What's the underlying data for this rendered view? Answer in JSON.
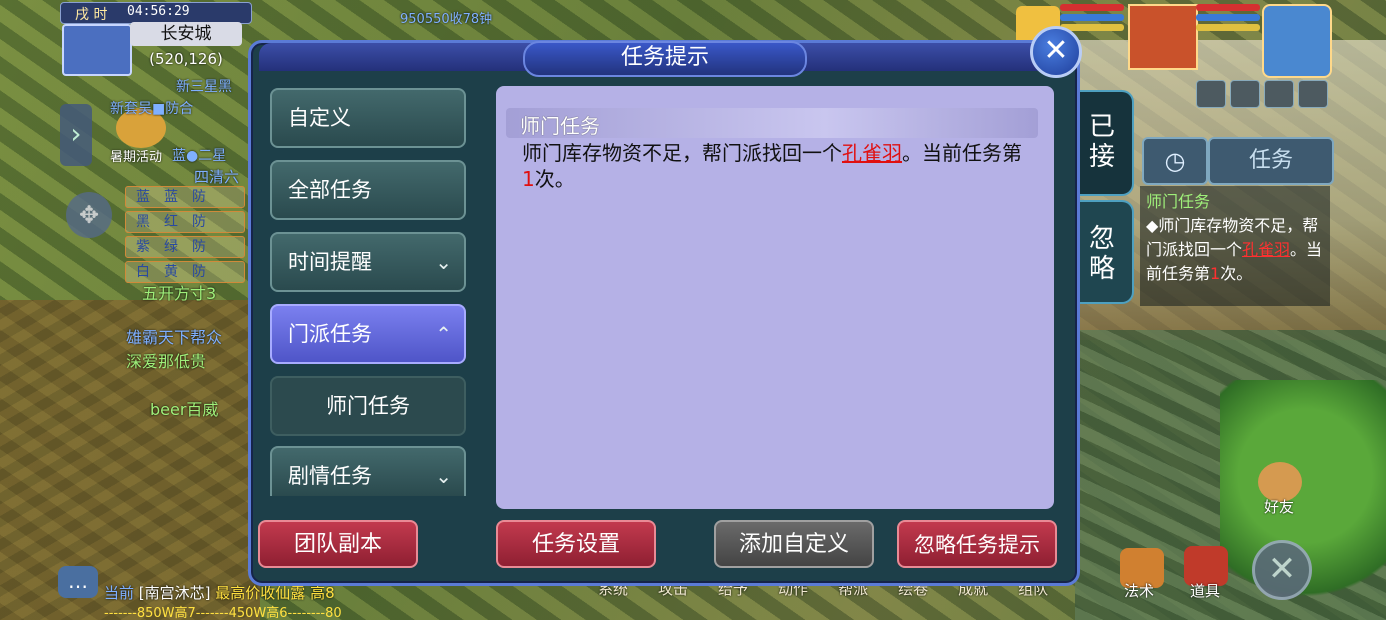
{
  "hud": {
    "time_period": "戌 时",
    "clock": "04:56:29",
    "map_name": "长安城",
    "coords": "(520,126)"
  },
  "world_text": {
    "buff_items": [
      "蓝　蓝　防",
      "黑　红　防",
      "紫　绿　防",
      "白　黄　防"
    ],
    "stall_1": "新三星黑",
    "stall_2": "新套吴■防合",
    "event_label": "暑期活动",
    "stall_3": "蓝●二星",
    "stall_4": "四清六",
    "npc_1": "五开方寸3",
    "npc_2": "雄霸天下帮众",
    "npc_3": "深爱那低贵",
    "npc_4": "beer百威",
    "stall_5": "950550收78钟"
  },
  "dialog": {
    "title": "任务提示",
    "close_symbol": "✕"
  },
  "side_tabs": {
    "accepted": "已接",
    "ignored": "忽略"
  },
  "menu": [
    {
      "label": "自定义"
    },
    {
      "label": "全部任务"
    },
    {
      "label": "时间提醒",
      "chevron": "⌄"
    },
    {
      "label": "门派任务",
      "chevron": "⌃"
    },
    {
      "label": "师门任务"
    },
    {
      "label": "剧情任务",
      "chevron": "⌄"
    }
  ],
  "content": {
    "header": "师门任务",
    "desc_prefix": "师门库存物资不足，帮门派找回一个",
    "item": "孔雀羽",
    "desc_mid": "。当前任务第",
    "count": "1",
    "desc_suffix": "次。"
  },
  "buttons": {
    "team_dungeon": "团队副本",
    "task_settings": "任务设置",
    "add_custom": "添加自定义",
    "ignore_tips": "忽略任务提示"
  },
  "tracker": {
    "timer_icon": "◷",
    "task_label": "任务",
    "title": "师门任务",
    "desc_prefix": "◆师门库存物资不足，帮门派找回一个",
    "item": "孔雀羽",
    "desc_mid": "。当前任务第",
    "count": "1",
    "desc_suffix": "次。"
  },
  "chat": {
    "channel": "当前",
    "sender": "[南宫沐芯]",
    "message": "最高价收仙露 高8",
    "line2": "-------850W高7-------450W高6--------80"
  },
  "bottom_menu": [
    "系统",
    "攻击",
    "给予",
    "动作",
    "帮派",
    "绘卷",
    "成就",
    "组队"
  ],
  "bottom_right": {
    "magic": "法术",
    "items": "道具",
    "friends": "好友"
  },
  "colors": {
    "dialog_bg": "#1d3f49",
    "content_bg": "#b5b1e6",
    "active_tab": "#6166e0",
    "action_red": "#a82c40",
    "highlight_red": "#e01010"
  }
}
